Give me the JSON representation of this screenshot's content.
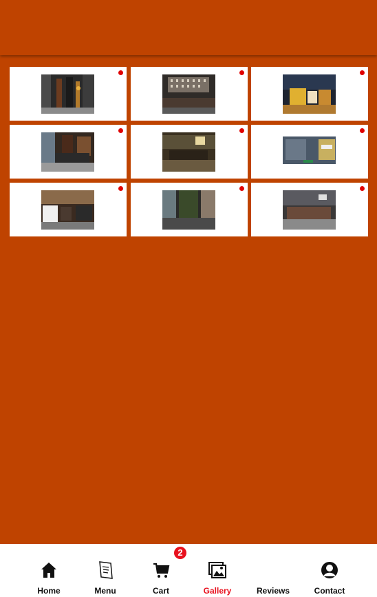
{
  "gallery": {
    "items": [
      {
        "name": "gallery-photo-1"
      },
      {
        "name": "gallery-photo-2"
      },
      {
        "name": "gallery-photo-3"
      },
      {
        "name": "gallery-photo-4"
      },
      {
        "name": "gallery-photo-5"
      },
      {
        "name": "gallery-photo-6"
      },
      {
        "name": "gallery-photo-7"
      },
      {
        "name": "gallery-photo-8"
      },
      {
        "name": "gallery-photo-9"
      }
    ]
  },
  "nav": {
    "items": [
      {
        "label": "Home",
        "icon": "home-icon"
      },
      {
        "label": "Menu",
        "icon": "menu-book-icon"
      },
      {
        "label": "Cart",
        "icon": "cart-icon"
      },
      {
        "label": "Gallery",
        "icon": "gallery-icon"
      },
      {
        "label": "Reviews",
        "icon": "reviews-icon"
      },
      {
        "label": "Contact",
        "icon": "contact-icon"
      }
    ],
    "active": "Gallery",
    "cart_badge": "2"
  },
  "colors": {
    "background": "#bf4300",
    "accent": "#e8111e",
    "dot": "#e00000"
  }
}
